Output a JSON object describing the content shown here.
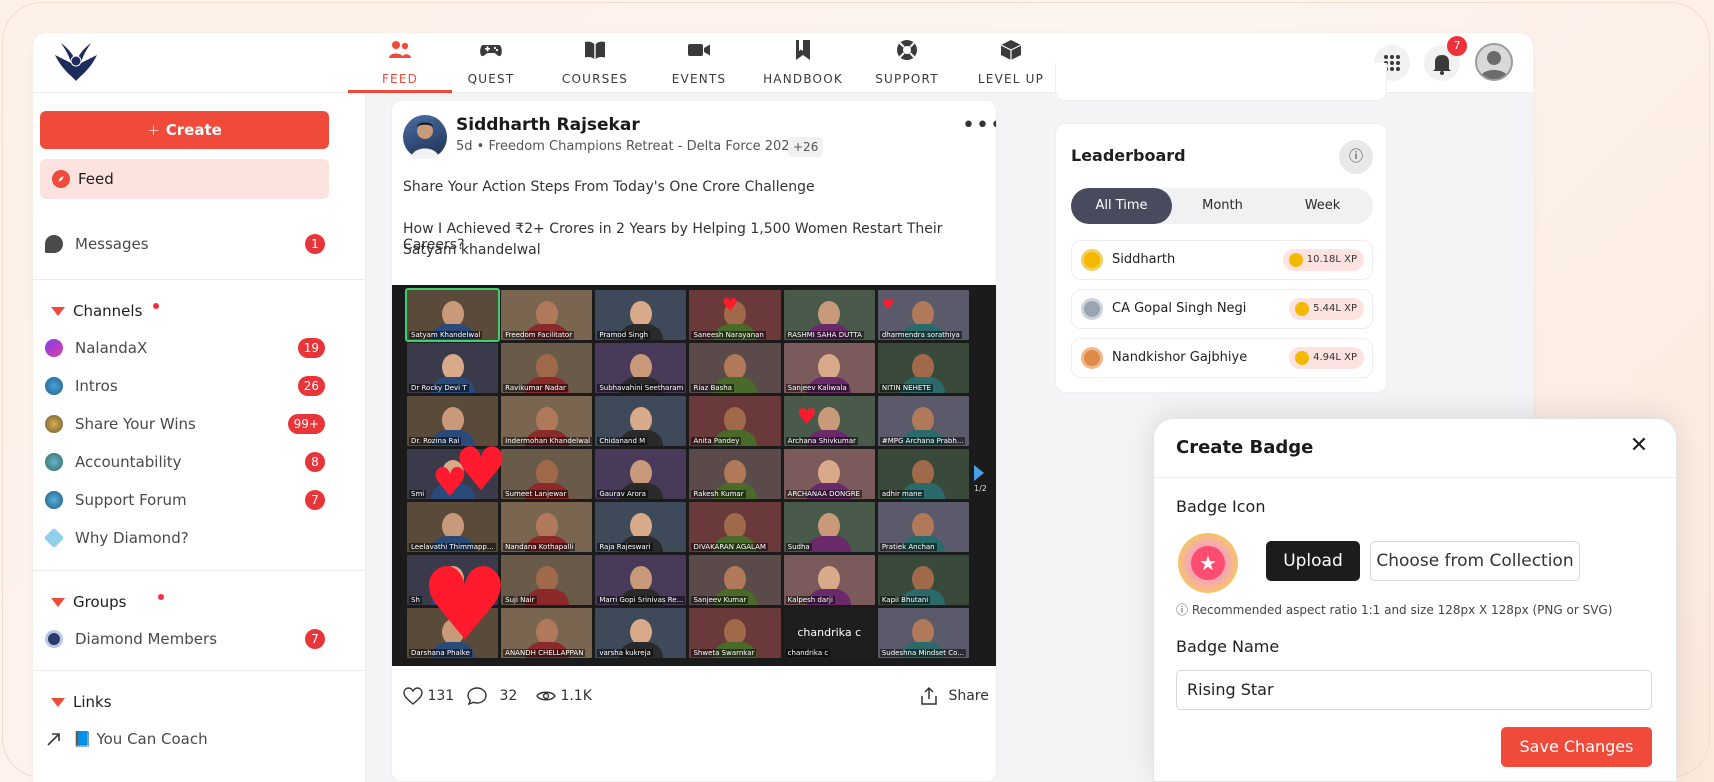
{
  "nav": {
    "items": [
      {
        "label": "FEED",
        "icon": "users-icon",
        "active": true
      },
      {
        "label": "QUEST",
        "icon": "gamepad-icon",
        "active": false
      },
      {
        "label": "COURSES",
        "icon": "book-icon",
        "active": false
      },
      {
        "label": "EVENTS",
        "icon": "video-icon",
        "active": false
      },
      {
        "label": "HANDBOOK",
        "icon": "bookmark-icon",
        "active": false
      },
      {
        "label": "SUPPORT",
        "icon": "lifebuoy-icon",
        "active": false
      },
      {
        "label": "LEVEL UP",
        "icon": "cube-icon",
        "active": false
      }
    ],
    "notifications_count": "7",
    "accent": "#f04a3a"
  },
  "sidebar": {
    "create_label": "Create",
    "feed_label": "Feed",
    "messages": {
      "label": "Messages",
      "badge": "1"
    },
    "channels": {
      "title": "Channels",
      "items": [
        {
          "label": "NalandaX",
          "badge": "19"
        },
        {
          "label": "Intros",
          "badge": "26"
        },
        {
          "label": "Share Your Wins",
          "badge": "99+"
        },
        {
          "label": "Accountability",
          "badge": "8"
        },
        {
          "label": "Support Forum",
          "badge": "7"
        },
        {
          "label": "Why Diamond?",
          "badge": ""
        }
      ]
    },
    "groups": {
      "title": "Groups",
      "items": [
        {
          "label": "Diamond Members",
          "badge": "7"
        }
      ]
    },
    "links": {
      "title": "Links",
      "items": [
        {
          "label": "📘 You Can Coach"
        }
      ]
    }
  },
  "post": {
    "author": "Siddharth Rajsekar",
    "meta": "5d • Freedom Champions Retreat - Delta Force 2026",
    "extra": "+26",
    "line1": "Share Your Action Steps From Today's One Crore Challenge",
    "line2": "How I Achieved ₹2+ Crores in 2 Years by Helping 1,500 Women Restart Their Careers?",
    "line3": "Satyam khandelwal",
    "participants": [
      "Satyam Khandelwal",
      "Freedom Facilitator",
      "Pramod Singh",
      "Saneesh Narayanan",
      "RASHMI SAHA DUTTA",
      "dharmendra sorathiya",
      "Dr Rocky Devi T",
      "Ravikumar Nadar",
      "Subhavahini Seetharam",
      "Riaz Basha",
      "Sanjeev Kaliwala",
      "NITIN NEHETE",
      "Dr. Rozina Rai",
      "Indermohan Khandelwal",
      "Chidanand M",
      "Anita Pandey",
      "Archana Shivkumar",
      "#MPG Archana Prabh...",
      "Smi",
      "Sumeet Lanjewar",
      "Gaurav Arora",
      "Rakesh Kumar",
      "ARCHANAA DONGRE",
      "adhir mane",
      "Leelavathi Thimmapp...",
      "Nandana Kothapalli",
      "Raja Rajeswari",
      "DIVAKARAN AGALAM",
      "Sudha",
      "Pratiek Anchan",
      "Sh",
      "Suji Nair",
      "Marri Gopi Srinivas Re...",
      "Sanjeev Kumar",
      "Kalpesh darji",
      "Kapil Bhutani",
      "Darshana Phalke",
      "ANANDH CHELLAPPAN",
      "varsha kukreja",
      "Shweta Swarnkar",
      "chandrika c",
      "Sudeshna Mindset Co..."
    ],
    "center_name": "chandrika c",
    "page_indicator": "1/2",
    "likes": "131",
    "comments": "32",
    "views": "1.1K",
    "share_label": "Share"
  },
  "leaderboard": {
    "title": "Leaderboard",
    "tabs": [
      "All Time",
      "Month",
      "Week"
    ],
    "active_tab": "All Time",
    "rows": [
      {
        "name": "Siddharth",
        "xp": "10.18L XP",
        "rank": "1"
      },
      {
        "name": "CA Gopal Singh Negi",
        "xp": "5.44L XP",
        "rank": "2"
      },
      {
        "name": "Nandkishor Gajbhiye",
        "xp": "4.94L XP",
        "rank": "3"
      }
    ]
  },
  "badge_modal": {
    "title": "Create Badge",
    "icon_label": "Badge Icon",
    "upload_label": "Upload",
    "collection_label": "Choose from Collection",
    "hint": "Recommended aspect ratio 1:1 and size 128px X 128px (PNG or SVG)",
    "name_label": "Badge Name",
    "name_value": "Rising Star",
    "save_label": "Save Changes"
  }
}
